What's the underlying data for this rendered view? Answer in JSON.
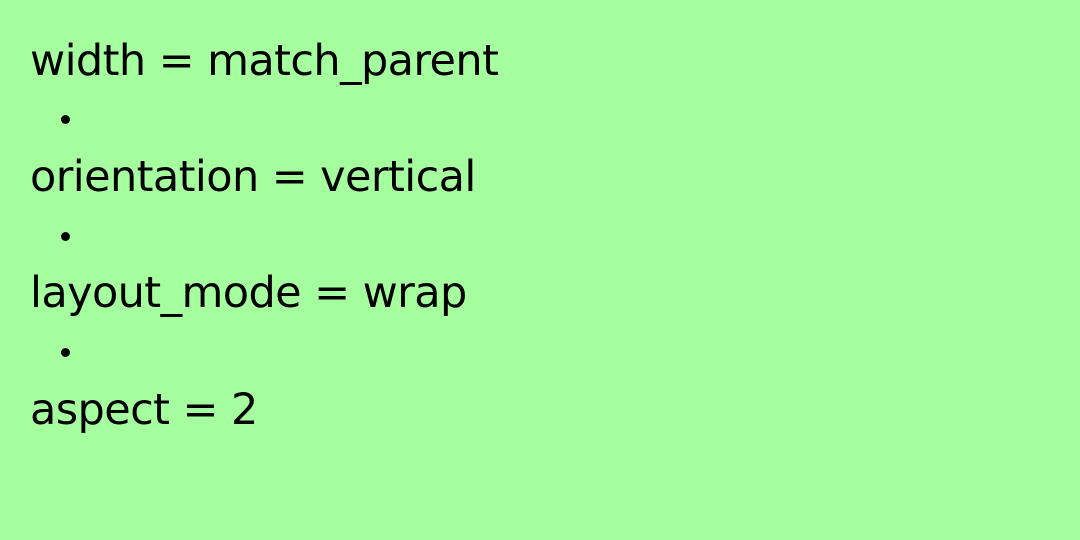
{
  "background_color": "#a5ff9f",
  "text_color": "#000000",
  "properties": [
    {
      "text": "width = match_parent"
    },
    {
      "text": "orientation = vertical"
    },
    {
      "text": "layout_mode = wrap"
    },
    {
      "text": "aspect = 2"
    }
  ]
}
